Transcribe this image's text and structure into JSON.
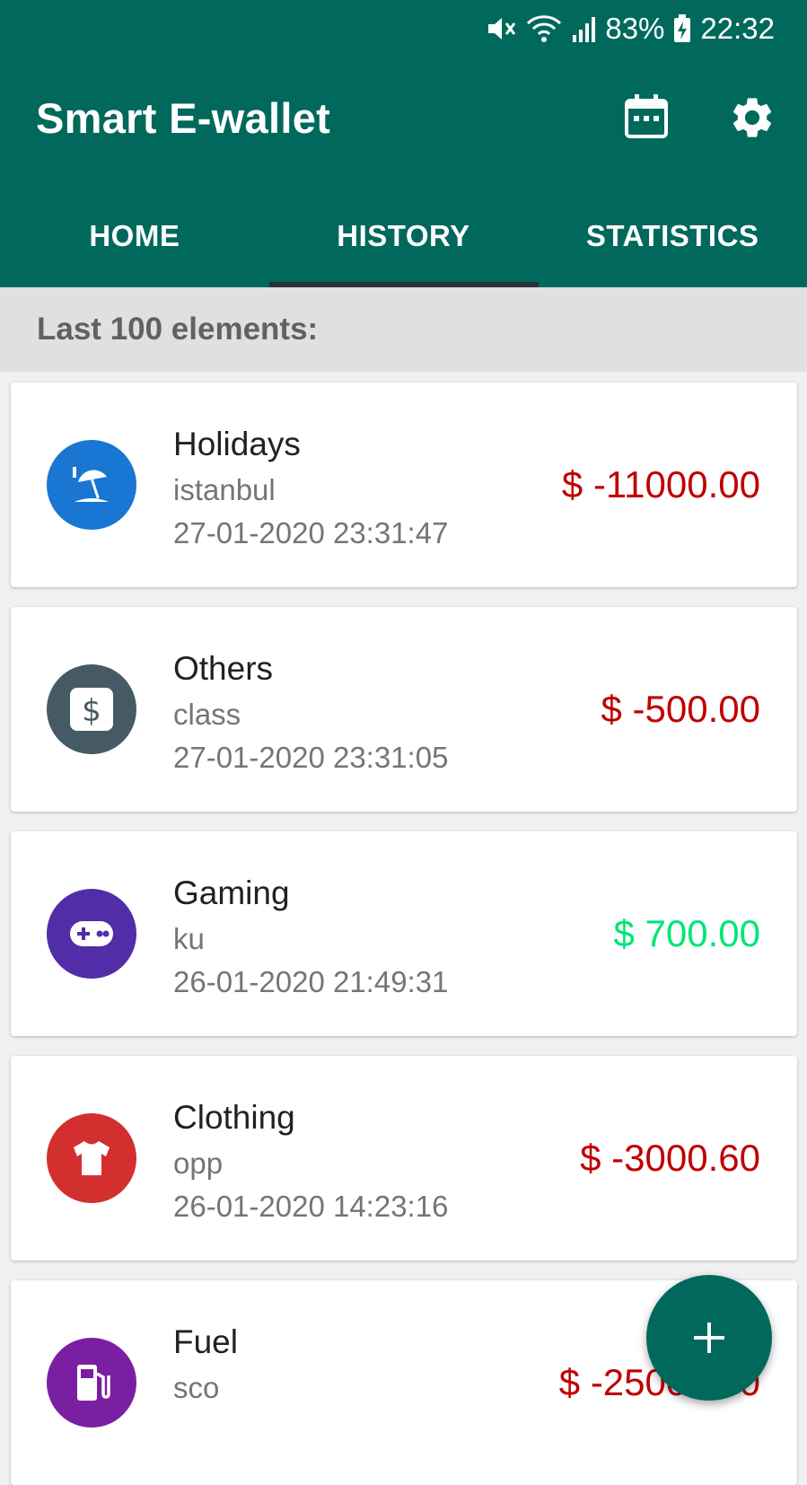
{
  "status_bar": {
    "battery": "83%",
    "time": "22:32"
  },
  "app_bar": {
    "title": "Smart E-wallet",
    "calendar_icon": "calendar-icon",
    "settings_icon": "gear-icon"
  },
  "tabs": [
    {
      "label": "HOME",
      "selected": false
    },
    {
      "label": "HISTORY",
      "selected": true
    },
    {
      "label": "STATISTICS",
      "selected": false
    }
  ],
  "section_header": "Last 100 elements:",
  "transactions": [
    {
      "category": "Holidays",
      "note": "istanbul",
      "date": "27-01-2020 23:31:47",
      "amount": "$ -11000.00",
      "amount_color": "#c00000",
      "icon": "beach-umbrella-icon",
      "icon_color": "#1976d2"
    },
    {
      "category": "Others",
      "note": "class",
      "date": "27-01-2020 23:31:05",
      "amount": "$ -500.00",
      "amount_color": "#c00000",
      "icon": "dollar-icon",
      "icon_color": "#455a64"
    },
    {
      "category": "Gaming",
      "note": "ku",
      "date": "26-01-2020 21:49:31",
      "amount": "$ 700.00",
      "amount_color": "#00e676",
      "icon": "gamepad-icon",
      "icon_color": "#512da8"
    },
    {
      "category": "Clothing",
      "note": "opp",
      "date": "26-01-2020 14:23:16",
      "amount": "$ -3000.60",
      "amount_color": "#c00000",
      "icon": "tshirt-icon",
      "icon_color": "#d32f2f"
    },
    {
      "category": "Fuel",
      "note": "sco",
      "date": "",
      "amount": "$ -25000.00",
      "amount_color": "#c00000",
      "icon": "fuel-pump-icon",
      "icon_color": "#7b1fa2"
    }
  ],
  "fab": {
    "icon": "plus-icon"
  }
}
